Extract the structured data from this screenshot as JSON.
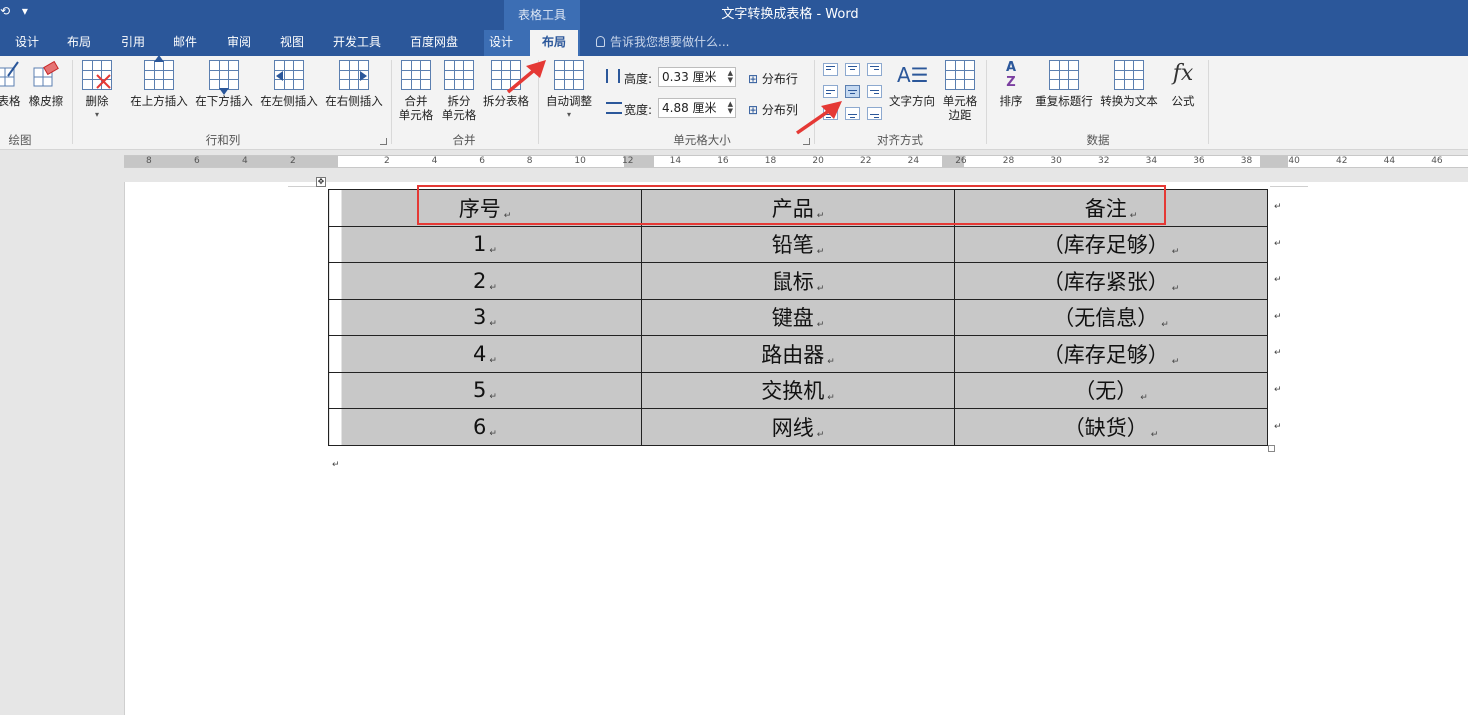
{
  "window": {
    "title": "文字转换成表格 - Word",
    "context_group": "表格工具"
  },
  "tabs": [
    "设计",
    "布局",
    "引用",
    "邮件",
    "审阅",
    "视图",
    "开发工具",
    "百度网盘",
    "设计",
    "布局"
  ],
  "active_tab": "布局",
  "tell_me": "告诉我您想要做什么...",
  "ribbon": {
    "draw": {
      "label": "绘图",
      "buttons": [
        "表格",
        "橡皮擦"
      ]
    },
    "rows_cols": {
      "label": "行和列",
      "delete": "删除",
      "buttons": [
        "在上方插入",
        "在下方插入",
        "在左侧插入",
        "在右侧插入"
      ]
    },
    "merge": {
      "label": "合并",
      "merge_cells": [
        "合并",
        "单元格"
      ],
      "split_cells": [
        "拆分",
        "单元格"
      ],
      "split_table": "拆分表格"
    },
    "cell_size": {
      "label": "单元格大小",
      "autofit": "自动调整",
      "height_label": "高度:",
      "height_value": "0.33 厘米",
      "width_label": "宽度:",
      "width_value": "4.88 厘米",
      "distribute_rows": "分布行",
      "distribute_cols": "分布列"
    },
    "alignment": {
      "label": "对齐方式",
      "text_direction": "文字方向",
      "cell_margins": [
        "单元格",
        "边距"
      ]
    },
    "data": {
      "label": "数据",
      "sort": "排序",
      "repeat_header": "重复标题行",
      "convert_to_text": "转换为文本",
      "formula": "公式",
      "formula_glyph": "fx"
    }
  },
  "ruler": {
    "left_numbers": [
      "8",
      "6",
      "4",
      "2"
    ],
    "right_numbers": [
      "2",
      "4",
      "6",
      "8",
      "10",
      "12",
      "14",
      "16",
      "18",
      "20",
      "22",
      "24",
      "26",
      "28",
      "30",
      "32",
      "34",
      "36",
      "38",
      "40",
      "42",
      "44",
      "46"
    ]
  },
  "table": {
    "header": [
      "序号",
      "产品",
      "备注"
    ],
    "rows": [
      [
        "1",
        "铅笔",
        "（库存足够）"
      ],
      [
        "2",
        "鼠标",
        "（库存紧张）"
      ],
      [
        "3",
        "键盘",
        "（无信息）"
      ],
      [
        "4",
        "路由器",
        "（库存足够）"
      ],
      [
        "5",
        "交换机",
        "（无）"
      ],
      [
        "6",
        "网线",
        "（缺货）"
      ]
    ]
  },
  "colors": {
    "title_bar": "#2b579a",
    "context_tab": "#3c6eb4",
    "ribbon": "#f3f3f3",
    "cell_fill": "#c8c8c8",
    "annotation": "#e53935"
  }
}
